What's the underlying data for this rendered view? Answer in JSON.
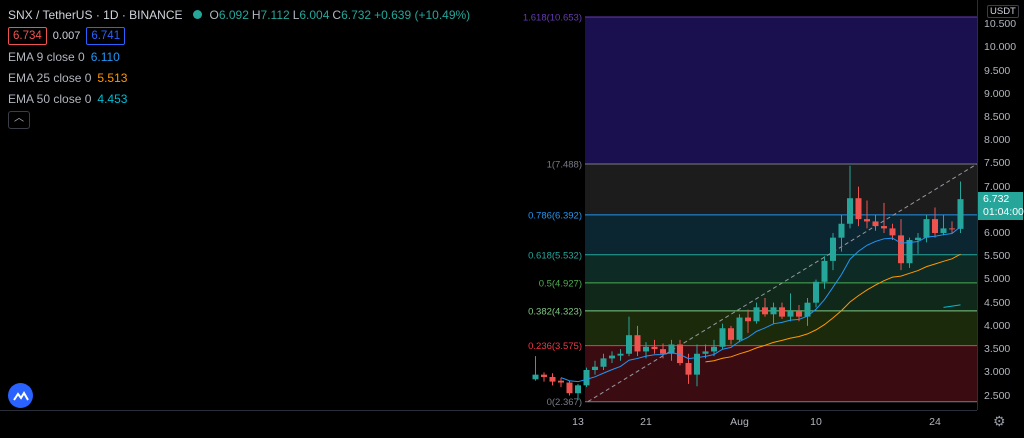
{
  "header": {
    "symbol": "SNX / TetherUS · 1D · BINANCE",
    "ohlc": [
      {
        "k": "O",
        "v": "6.092"
      },
      {
        "k": "H",
        "v": "7.112"
      },
      {
        "k": "L",
        "v": "6.004"
      },
      {
        "k": "C",
        "v": "6.732"
      }
    ],
    "change": "+0.639 (+10.49%)",
    "bid": "6.734",
    "spread": "0.007",
    "ask": "6.741"
  },
  "emas": [
    {
      "label": "EMA 9 close 0",
      "value": "6.110",
      "color": "#2196f3"
    },
    {
      "label": "EMA 25 close 0",
      "value": "5.513",
      "color": "#ff9800"
    },
    {
      "label": "EMA 50 close 0",
      "value": "4.453",
      "color": "#00bcd4"
    }
  ],
  "price_scale": {
    "currency": "USDT",
    "ticks": [
      "10.500",
      "10.000",
      "9.500",
      "9.000",
      "8.500",
      "8.000",
      "7.500",
      "7.000",
      "6.500",
      "6.000",
      "5.500",
      "5.000",
      "4.500",
      "4.000",
      "3.500",
      "3.000",
      "2.500"
    ],
    "last_price": "6.732",
    "countdown": "01:04:00"
  },
  "time_scale": {
    "labels": [
      {
        "t": "13",
        "x": 0
      },
      {
        "t": "21",
        "x": 8
      },
      {
        "t": "Aug",
        "x": 19
      },
      {
        "t": "10",
        "x": 28
      },
      {
        "t": "24",
        "x": 42
      }
    ]
  },
  "fib_levels": [
    {
      "label": "1.618(10.653)",
      "price": 10.653,
      "color": "#673ab7"
    },
    {
      "label": "1(7.488)",
      "price": 7.488,
      "color": "#787b86"
    },
    {
      "label": "0.786(6.392)",
      "price": 6.392,
      "color": "#2196f3"
    },
    {
      "label": "0.618(5.532)",
      "price": 5.532,
      "color": "#26a69a"
    },
    {
      "label": "0.5(4.927)",
      "price": 4.927,
      "color": "#4caf50"
    },
    {
      "label": "0.382(4.323)",
      "price": 4.323,
      "color": "#81c784"
    },
    {
      "label": "0.236(3.575)",
      "price": 3.575,
      "color": "#f23645"
    },
    {
      "label": "0(2.367)",
      "price": 2.367,
      "color": "#787b86"
    }
  ],
  "colors": {
    "up": "#26a69a",
    "down": "#ef5350",
    "accent": "#2962ff"
  },
  "chart_data": {
    "type": "candlestick",
    "x_unit": "days from Jul 13",
    "ylim": [
      2.367,
      10.97
    ],
    "candles": [
      {
        "x": -5,
        "o": 2.85,
        "h": 3.35,
        "l": 2.82,
        "c": 2.95
      },
      {
        "x": -4,
        "o": 2.95,
        "h": 3.0,
        "l": 2.8,
        "c": 2.9
      },
      {
        "x": -3,
        "o": 2.9,
        "h": 2.98,
        "l": 2.72,
        "c": 2.8
      },
      {
        "x": -2,
        "o": 2.82,
        "h": 2.88,
        "l": 2.68,
        "c": 2.78
      },
      {
        "x": -1,
        "o": 2.78,
        "h": 2.82,
        "l": 2.5,
        "c": 2.55
      },
      {
        "x": 0,
        "o": 2.55,
        "h": 2.75,
        "l": 2.4,
        "c": 2.72
      },
      {
        "x": 1,
        "o": 2.72,
        "h": 3.1,
        "l": 2.68,
        "c": 3.05
      },
      {
        "x": 2,
        "o": 3.05,
        "h": 3.25,
        "l": 2.95,
        "c": 3.12
      },
      {
        "x": 3,
        "o": 3.12,
        "h": 3.4,
        "l": 3.05,
        "c": 3.3
      },
      {
        "x": 4,
        "o": 3.3,
        "h": 3.45,
        "l": 3.2,
        "c": 3.36
      },
      {
        "x": 5,
        "o": 3.36,
        "h": 3.5,
        "l": 3.25,
        "c": 3.4
      },
      {
        "x": 6,
        "o": 3.4,
        "h": 4.2,
        "l": 3.35,
        "c": 3.8
      },
      {
        "x": 7,
        "o": 3.8,
        "h": 4.0,
        "l": 3.35,
        "c": 3.45
      },
      {
        "x": 8,
        "o": 3.45,
        "h": 3.65,
        "l": 3.3,
        "c": 3.55
      },
      {
        "x": 9,
        "o": 3.55,
        "h": 3.7,
        "l": 3.4,
        "c": 3.5
      },
      {
        "x": 10,
        "o": 3.5,
        "h": 3.62,
        "l": 3.3,
        "c": 3.4
      },
      {
        "x": 11,
        "o": 3.4,
        "h": 3.7,
        "l": 3.25,
        "c": 3.6
      },
      {
        "x": 12,
        "o": 3.6,
        "h": 3.7,
        "l": 3.15,
        "c": 3.2
      },
      {
        "x": 13,
        "o": 3.2,
        "h": 3.4,
        "l": 2.75,
        "c": 2.95
      },
      {
        "x": 14,
        "o": 2.95,
        "h": 3.6,
        "l": 2.7,
        "c": 3.4
      },
      {
        "x": 15,
        "o": 3.4,
        "h": 3.6,
        "l": 3.3,
        "c": 3.45
      },
      {
        "x": 16,
        "o": 3.45,
        "h": 3.7,
        "l": 3.35,
        "c": 3.55
      },
      {
        "x": 17,
        "o": 3.55,
        "h": 4.05,
        "l": 3.5,
        "c": 3.95
      },
      {
        "x": 18,
        "o": 3.95,
        "h": 4.0,
        "l": 3.6,
        "c": 3.7
      },
      {
        "x": 19,
        "o": 3.7,
        "h": 4.25,
        "l": 3.65,
        "c": 4.18
      },
      {
        "x": 20,
        "o": 4.18,
        "h": 4.35,
        "l": 3.85,
        "c": 4.1
      },
      {
        "x": 21,
        "o": 4.1,
        "h": 4.5,
        "l": 4.05,
        "c": 4.4
      },
      {
        "x": 22,
        "o": 4.4,
        "h": 4.6,
        "l": 4.2,
        "c": 4.25
      },
      {
        "x": 23,
        "o": 4.25,
        "h": 4.5,
        "l": 4.05,
        "c": 4.4
      },
      {
        "x": 24,
        "o": 4.4,
        "h": 4.5,
        "l": 4.15,
        "c": 4.2
      },
      {
        "x": 25,
        "o": 4.2,
        "h": 4.7,
        "l": 4.1,
        "c": 4.32
      },
      {
        "x": 26,
        "o": 4.32,
        "h": 4.45,
        "l": 4.1,
        "c": 4.2
      },
      {
        "x": 27,
        "o": 4.2,
        "h": 4.6,
        "l": 4.0,
        "c": 4.5
      },
      {
        "x": 28,
        "o": 4.5,
        "h": 5.0,
        "l": 4.4,
        "c": 4.95
      },
      {
        "x": 29,
        "o": 4.95,
        "h": 5.5,
        "l": 4.8,
        "c": 5.4
      },
      {
        "x": 30,
        "o": 5.4,
        "h": 6.0,
        "l": 5.2,
        "c": 5.9
      },
      {
        "x": 31,
        "o": 5.9,
        "h": 6.4,
        "l": 5.6,
        "c": 6.2
      },
      {
        "x": 32,
        "o": 6.2,
        "h": 7.45,
        "l": 6.1,
        "c": 6.75
      },
      {
        "x": 33,
        "o": 6.75,
        "h": 7.0,
        "l": 6.15,
        "c": 6.3
      },
      {
        "x": 34,
        "o": 6.3,
        "h": 6.7,
        "l": 6.1,
        "c": 6.25
      },
      {
        "x": 35,
        "o": 6.25,
        "h": 6.4,
        "l": 6.05,
        "c": 6.15
      },
      {
        "x": 36,
        "o": 6.15,
        "h": 6.65,
        "l": 6.0,
        "c": 6.1
      },
      {
        "x": 37,
        "o": 6.1,
        "h": 6.2,
        "l": 5.85,
        "c": 5.95
      },
      {
        "x": 38,
        "o": 5.95,
        "h": 6.3,
        "l": 5.2,
        "c": 5.35
      },
      {
        "x": 39,
        "o": 5.35,
        "h": 5.9,
        "l": 5.25,
        "c": 5.85
      },
      {
        "x": 40,
        "o": 5.85,
        "h": 6.0,
        "l": 5.55,
        "c": 5.9
      },
      {
        "x": 41,
        "o": 5.9,
        "h": 6.4,
        "l": 5.8,
        "c": 6.3
      },
      {
        "x": 42,
        "o": 6.3,
        "h": 6.55,
        "l": 5.9,
        "c": 6.0
      },
      {
        "x": 43,
        "o": 6.0,
        "h": 6.4,
        "l": 5.95,
        "c": 6.1
      },
      {
        "x": 44,
        "o": 6.1,
        "h": 6.25,
        "l": 6.0,
        "c": 6.09
      },
      {
        "x": 45,
        "o": 6.09,
        "h": 7.11,
        "l": 6.0,
        "c": 6.73
      }
    ]
  }
}
